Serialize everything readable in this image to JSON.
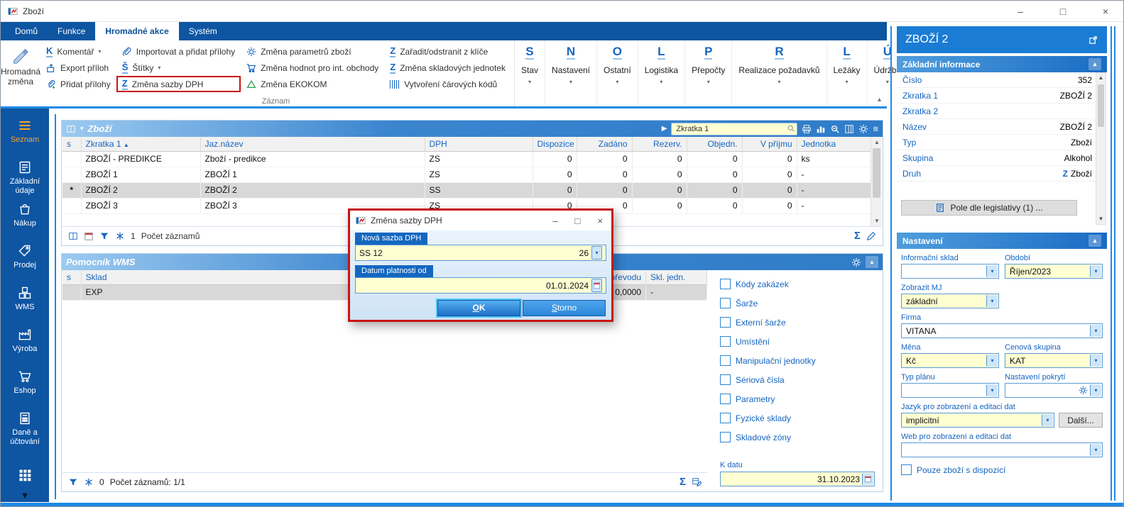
{
  "window": {
    "title": "Zboží"
  },
  "tabs": [
    {
      "label": "Domů"
    },
    {
      "label": "Funkce"
    },
    {
      "label": "Hromadné akce"
    },
    {
      "label": "Systém"
    }
  ],
  "ribbon": {
    "big_button": "Hromadná změna",
    "group_label": "Záznam",
    "items": {
      "komentar": "Komentář",
      "export_priloh": "Export příloh",
      "pridat_prilohy": "Přidat přílohy",
      "importovat": "Importovat a přidat přílohy",
      "stitky": "Štítky",
      "zmena_dph": "Změna sazby DPH",
      "zmena_parametru": "Změna parametrů zboží",
      "zmena_hodnot": "Změna hodnot pro int. obchody",
      "zmena_ekokom": "Změna EKOKOM",
      "zaradit": "Zařadit/odstranit z klíče",
      "zmena_jednotek": "Změna skladových jednotek",
      "vytvoreni_kodu": "Vytvoření čárových kódů"
    },
    "menus": [
      {
        "letter": "S",
        "label": "Stav"
      },
      {
        "letter": "N",
        "label": "Nastavení"
      },
      {
        "letter": "O",
        "label": "Ostatní"
      },
      {
        "letter": "L",
        "label": "Logistika"
      },
      {
        "letter": "P",
        "label": "Přepočty"
      },
      {
        "letter": "R",
        "label": "Realizace požadavků"
      },
      {
        "letter": "L",
        "label": "Ležáky"
      },
      {
        "letter": "Ú",
        "label": "Údržba"
      }
    ]
  },
  "sidebar": [
    {
      "label": "Seznam"
    },
    {
      "label": "Základní údaje"
    },
    {
      "label": "Nákup"
    },
    {
      "label": "Prodej"
    },
    {
      "label": "WMS"
    },
    {
      "label": "Výroba"
    },
    {
      "label": "Eshop"
    },
    {
      "label": "Daně a účtování"
    }
  ],
  "grid": {
    "title": "Zboží",
    "search_value": "Zkratka 1",
    "columns": [
      "s",
      "Zkratka 1",
      "Jaz.název",
      "DPH",
      "Dispozice",
      "Zadáno",
      "Rezerv.",
      "Objedn.",
      "V příjmu",
      "Jednotka"
    ],
    "rows": [
      [
        "",
        "ZBOŽÍ - PREDIKCE",
        "Zboží - predikce",
        "ZS",
        "0",
        "0",
        "0",
        "0",
        "0",
        "ks"
      ],
      [
        "",
        "ZBOŽÍ 1",
        "ZBOŽÍ 1",
        "ZS",
        "0",
        "0",
        "0",
        "0",
        "0",
        "-"
      ],
      [
        "*",
        "ZBOŽÍ 2",
        "ZBOŽÍ 2",
        "SS",
        "0",
        "0",
        "0",
        "0",
        "0",
        "-"
      ],
      [
        "",
        "ZBOŽÍ 3",
        "ZBOŽÍ 3",
        "ZS",
        "0",
        "0",
        "0",
        "0",
        "0",
        "-"
      ]
    ],
    "footer": {
      "count": "1",
      "label": "Počet záznamů"
    }
  },
  "wms": {
    "title": "Pomocník WMS",
    "columns": [
      "s",
      "Sklad",
      "V převodu",
      "Skl. jedn."
    ],
    "row": {
      "sklad": "EXP",
      "v_prevodu": "0,0000",
      "skl_jedn": "-"
    },
    "footer": {
      "count": "0",
      "label": "Počet záznamů: 1/1"
    }
  },
  "options": {
    "items": [
      "Kódy zakázek",
      "Šarže",
      "Externí šarže",
      "Umístění",
      "Manipulační jednotky",
      "Sériová čísla",
      "Parametry",
      "Fyzické sklady",
      "Skladové zóny"
    ],
    "k_datu_label": "K datu",
    "k_datu_value": "31.10.2023"
  },
  "dialog": {
    "title": "Změna sazby DPH",
    "field1_label": "Nová sazba DPH",
    "field1_value": "SS 12",
    "field1_code": "26",
    "field2_label": "Datum platnosti od",
    "field2_value": "01.01.2024",
    "ok": "OK",
    "cancel": "Storno"
  },
  "detail": {
    "title": "ZBOŽÍ 2",
    "section1": {
      "title": "Základní informace",
      "rows": [
        {
          "label": "Číslo",
          "value": "352"
        },
        {
          "label": "Zkratka 1",
          "value": "ZBOŽÍ 2"
        },
        {
          "label": "Zkratka 2",
          "value": ""
        },
        {
          "label": "Název",
          "value": "ZBOŽÍ 2"
        },
        {
          "label": "Typ",
          "value": "Zboží"
        },
        {
          "label": "Skupina",
          "value": "Alkohol"
        },
        {
          "label": "Druh",
          "value": "Zboží",
          "value_icon": "Z"
        }
      ],
      "legislative_button": "Pole dle legislativy (1) ..."
    },
    "section2": {
      "title": "Nastavení",
      "informacni_sklad_label": "Informační sklad",
      "informacni_sklad_value": "",
      "obdobi_label": "Období",
      "obdobi_value": "Říjen/2023",
      "zobrazit_mj_label": "Zobrazit MJ",
      "zobrazit_mj_value": "základní",
      "firma_label": "Firma",
      "firma_value": "VITANA",
      "mena_label": "Měna",
      "mena_value": "Kč",
      "cenova_skupina_label": "Cenová skupina",
      "cenova_skupina_value": "KAT",
      "typ_planu_label": "Typ plánu",
      "typ_planu_value": "",
      "nastaveni_pokryti_label": "Nastavení pokrytí",
      "nastaveni_pokryti_value": "",
      "jazyk_label": "Jazyk pro zobrazení a editaci dat",
      "jazyk_value": "implicitní",
      "dalsi_button": "Další...",
      "web_label": "Web pro zobrazení a editaci dat",
      "web_value": "",
      "checkbox_label": "Pouze zboží s dispozicí"
    }
  },
  "colors": {
    "accent_blue": "#1565c0",
    "dark_blue": "#0e55a2",
    "bright_blue": "#1b7cd4",
    "highlight_red": "#c81414",
    "field_yellow": "#ffffd2",
    "active_orange": "#ffa51e"
  }
}
